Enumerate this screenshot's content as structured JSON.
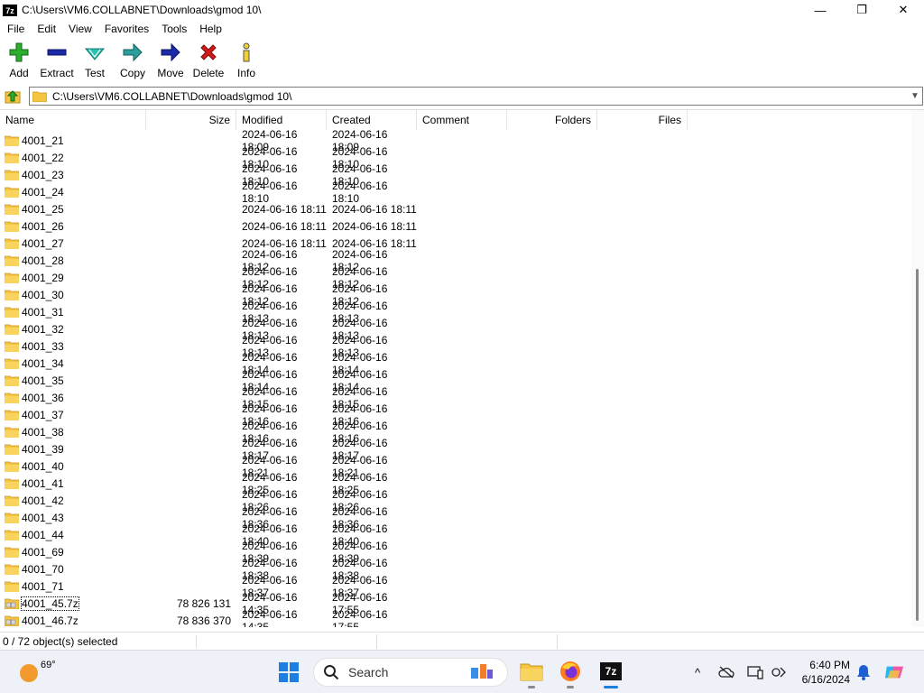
{
  "window": {
    "title": "C:\\Users\\VM6.COLLABNET\\Downloads\\gmod 10\\",
    "app_icon_text": "7z",
    "minimize_glyph": "—",
    "maximize_glyph": "❐",
    "close_glyph": "✕"
  },
  "menu": [
    "File",
    "Edit",
    "View",
    "Favorites",
    "Tools",
    "Help"
  ],
  "toolbar": [
    {
      "label": "Add",
      "icon": "plus-icon"
    },
    {
      "label": "Extract",
      "icon": "minus-icon"
    },
    {
      "label": "Test",
      "icon": "check-icon"
    },
    {
      "label": "Copy",
      "icon": "arrow-right-icon"
    },
    {
      "label": "Move",
      "icon": "arrow-right-icon"
    },
    {
      "label": "Delete",
      "icon": "x-icon"
    },
    {
      "label": "Info",
      "icon": "info-icon"
    }
  ],
  "address": {
    "path": "C:\\Users\\VM6.COLLABNET\\Downloads\\gmod 10\\"
  },
  "columns": [
    "Name",
    "Size",
    "Modified",
    "Created",
    "Comment",
    "Folders",
    "Files"
  ],
  "rows": [
    {
      "name": "4001_21",
      "size": "",
      "modified": "2024-06-16 18:09",
      "created": "2024-06-16 18:09",
      "type": "folder"
    },
    {
      "name": "4001_22",
      "size": "",
      "modified": "2024-06-16 18:10",
      "created": "2024-06-16 18:10",
      "type": "folder"
    },
    {
      "name": "4001_23",
      "size": "",
      "modified": "2024-06-16 18:10",
      "created": "2024-06-16 18:10",
      "type": "folder"
    },
    {
      "name": "4001_24",
      "size": "",
      "modified": "2024-06-16 18:10",
      "created": "2024-06-16 18:10",
      "type": "folder"
    },
    {
      "name": "4001_25",
      "size": "",
      "modified": "2024-06-16 18:11",
      "created": "2024-06-16 18:11",
      "type": "folder"
    },
    {
      "name": "4001_26",
      "size": "",
      "modified": "2024-06-16 18:11",
      "created": "2024-06-16 18:11",
      "type": "folder"
    },
    {
      "name": "4001_27",
      "size": "",
      "modified": "2024-06-16 18:11",
      "created": "2024-06-16 18:11",
      "type": "folder"
    },
    {
      "name": "4001_28",
      "size": "",
      "modified": "2024-06-16 18:12",
      "created": "2024-06-16 18:12",
      "type": "folder"
    },
    {
      "name": "4001_29",
      "size": "",
      "modified": "2024-06-16 18:12",
      "created": "2024-06-16 18:12",
      "type": "folder"
    },
    {
      "name": "4001_30",
      "size": "",
      "modified": "2024-06-16 18:12",
      "created": "2024-06-16 18:12",
      "type": "folder"
    },
    {
      "name": "4001_31",
      "size": "",
      "modified": "2024-06-16 18:13",
      "created": "2024-06-16 18:13",
      "type": "folder"
    },
    {
      "name": "4001_32",
      "size": "",
      "modified": "2024-06-16 18:13",
      "created": "2024-06-16 18:13",
      "type": "folder"
    },
    {
      "name": "4001_33",
      "size": "",
      "modified": "2024-06-16 18:13",
      "created": "2024-06-16 18:13",
      "type": "folder"
    },
    {
      "name": "4001_34",
      "size": "",
      "modified": "2024-06-16 18:14",
      "created": "2024-06-16 18:14",
      "type": "folder"
    },
    {
      "name": "4001_35",
      "size": "",
      "modified": "2024-06-16 18:14",
      "created": "2024-06-16 18:14",
      "type": "folder"
    },
    {
      "name": "4001_36",
      "size": "",
      "modified": "2024-06-16 18:15",
      "created": "2024-06-16 18:15",
      "type": "folder"
    },
    {
      "name": "4001_37",
      "size": "",
      "modified": "2024-06-16 18:16",
      "created": "2024-06-16 18:16",
      "type": "folder"
    },
    {
      "name": "4001_38",
      "size": "",
      "modified": "2024-06-16 18:16",
      "created": "2024-06-16 18:16",
      "type": "folder"
    },
    {
      "name": "4001_39",
      "size": "",
      "modified": "2024-06-16 18:17",
      "created": "2024-06-16 18:17",
      "type": "folder"
    },
    {
      "name": "4001_40",
      "size": "",
      "modified": "2024-06-16 18:21",
      "created": "2024-06-16 18:21",
      "type": "folder"
    },
    {
      "name": "4001_41",
      "size": "",
      "modified": "2024-06-16 18:25",
      "created": "2024-06-16 18:25",
      "type": "folder"
    },
    {
      "name": "4001_42",
      "size": "",
      "modified": "2024-06-16 18:26",
      "created": "2024-06-16 18:26",
      "type": "folder"
    },
    {
      "name": "4001_43",
      "size": "",
      "modified": "2024-06-16 18:36",
      "created": "2024-06-16 18:36",
      "type": "folder"
    },
    {
      "name": "4001_44",
      "size": "",
      "modified": "2024-06-16 18:40",
      "created": "2024-06-16 18:40",
      "type": "folder"
    },
    {
      "name": "4001_69",
      "size": "",
      "modified": "2024-06-16 18:39",
      "created": "2024-06-16 18:39",
      "type": "folder"
    },
    {
      "name": "4001_70",
      "size": "",
      "modified": "2024-06-16 18:38",
      "created": "2024-06-16 18:38",
      "type": "folder"
    },
    {
      "name": "4001_71",
      "size": "",
      "modified": "2024-06-16 18:37",
      "created": "2024-06-16 18:37",
      "type": "folder"
    },
    {
      "name": "4001_45.7z",
      "size": "78 826 131",
      "modified": "2024-06-16 14:35",
      "created": "2024-06-16 17:55",
      "type": "archive",
      "focused": true
    },
    {
      "name": "4001_46.7z",
      "size": "78 836 370",
      "modified": "2024-06-16 14:35",
      "created": "2024-06-16 17:55",
      "type": "archive"
    }
  ],
  "status": {
    "selection": "0 / 72 object(s) selected"
  },
  "taskbar": {
    "weather_temp": "69°",
    "search_placeholder": "Search",
    "apps": [
      "file-explorer-icon",
      "firefox-icon",
      "7zip-icon"
    ],
    "active_app_text": "7z",
    "time": "6:40 PM",
    "date": "6/16/2024"
  },
  "colors": {
    "folder": "#f5c542",
    "folder_dark": "#e2a92a",
    "accent": "#1c7fe0",
    "add_green": "#2cae2c",
    "extract_blue": "#1b2aa8",
    "test_teal": "#2bbfb0",
    "delete_red": "#d21a1a"
  }
}
